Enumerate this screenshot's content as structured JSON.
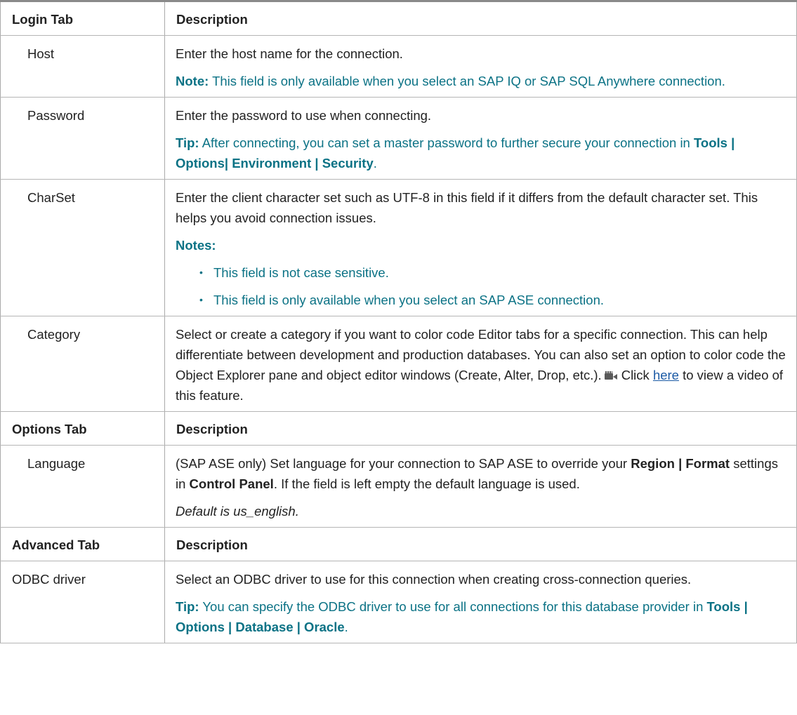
{
  "sections": {
    "login": {
      "col1": "Login Tab",
      "col2": "Description"
    },
    "options": {
      "col1": "Options Tab",
      "col2": "Description"
    },
    "advanced": {
      "col1": "Advanced Tab",
      "col2": "Description"
    }
  },
  "rows": {
    "host": {
      "name": "Host",
      "desc": "Enter the host name for the connection.",
      "note_label": "Note:",
      "note_text": " This field is only available when you select an SAP IQ or SAP SQL Anywhere connection."
    },
    "password": {
      "name": "Password",
      "desc": "Enter the password to use when connecting.",
      "tip_label": "Tip:",
      "tip_text": " After connecting, you can set a master password to further secure your connection in ",
      "tip_path": "Tools | Options| Environment | Security",
      "tip_end": "."
    },
    "charset": {
      "name": "CharSet",
      "desc": "Enter the client character set such as UTF-8 in this field if it differs from the default character set. This helps you avoid connection issues.",
      "notes_label": "Notes:",
      "bullets": [
        "This field is not case sensitive.",
        "This field is only available when you select an SAP ASE connection."
      ]
    },
    "category": {
      "name": "Category",
      "desc": "Select or create a category if you want to color code Editor tabs for a specific connection. This can help differentiate between development and production databases. You can also set an option to color code the Object Explorer pane and object editor windows (Create, Alter, Drop, etc.).",
      "icon": "video-camera-icon",
      "click": "Click ",
      "link": "here",
      "after_link": " to view a video of this feature."
    },
    "language": {
      "name": "Language",
      "desc_a": "(SAP ASE only) Set language for your connection to SAP ASE to override your ",
      "region": "Region | Format",
      "desc_b": " settings in ",
      "control": "Control Panel",
      "desc_c": ". If the field is left empty the default language is used.",
      "default": "Default is us_english."
    },
    "odbc": {
      "name": "ODBC driver",
      "desc": "Select an ODBC driver to use for this connection when creating cross-connection queries.",
      "tip_label": "Tip:",
      "tip_text": " You can specify the ODBC driver to use for all connections for this database provider in ",
      "tip_path": "Tools | Options | Database | Oracle",
      "tip_end": "."
    }
  }
}
